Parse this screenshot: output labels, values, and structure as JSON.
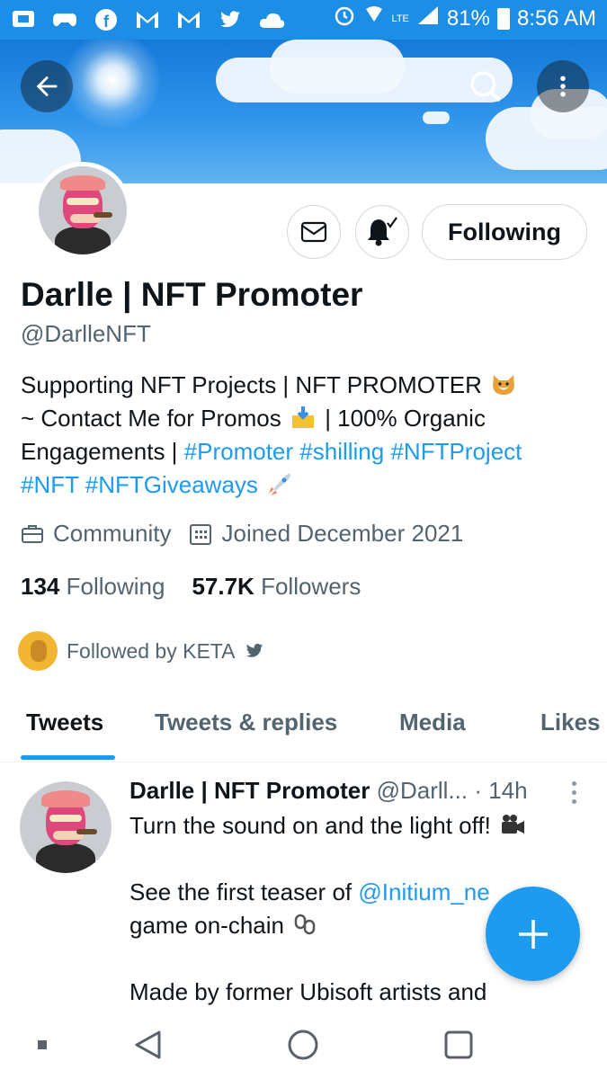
{
  "status_bar": {
    "battery": "81%",
    "time": "8:56 AM",
    "left_icons": [
      "screen-cast-icon",
      "game-controller-icon",
      "facebook-icon",
      "gmail-icon",
      "gmail-icon",
      "twitter-icon",
      "cloud-icon"
    ],
    "right_icons": [
      "alarm-icon",
      "wifi-icon",
      "lte-icon",
      "signal-icon",
      "battery-icon"
    ]
  },
  "profile": {
    "name": "Darlle | NFT Promoter",
    "handle": "@DarlleNFT",
    "following_button": "Following",
    "bio": {
      "line1": "Supporting NFT Projects | NFT PROMOTER",
      "line2a": "~ Contact Me for Promos",
      "line2b": "| 100% Organic",
      "line3a": "Engagements |",
      "tag_promoter": "#Promoter",
      "tag_shilling": "#shilling",
      "tag_nftproject": "#NFTProject",
      "tag_nft": "#NFT",
      "tag_giveaways": "#NFTGiveaways"
    },
    "category": "Community",
    "joined": "Joined December 2021",
    "following_count": "134",
    "following_label": "Following",
    "followers_count": "57.7K",
    "followers_label": "Followers",
    "followed_by": "Followed by KETA"
  },
  "tabs": [
    {
      "label": "Tweets",
      "active": true
    },
    {
      "label": "Tweets & replies",
      "active": false
    },
    {
      "label": "Media",
      "active": false
    },
    {
      "label": "Likes",
      "active": false
    }
  ],
  "tweet": {
    "author_name": "Darlle | NFT Promoter",
    "author_handle": "@Darll...",
    "time": "· 14h",
    "line1": "Turn the sound on and the light off!",
    "line2a": "See the first teaser of",
    "mention": "@Initium_ne",
    "line3": "game on-chain",
    "line4": "Made by former Ubisoft artists and"
  },
  "colors": {
    "accent": "#1d9bf0",
    "status_bar": "#1d8ee6",
    "text_primary": "#0f1419",
    "text_secondary": "#536471"
  }
}
